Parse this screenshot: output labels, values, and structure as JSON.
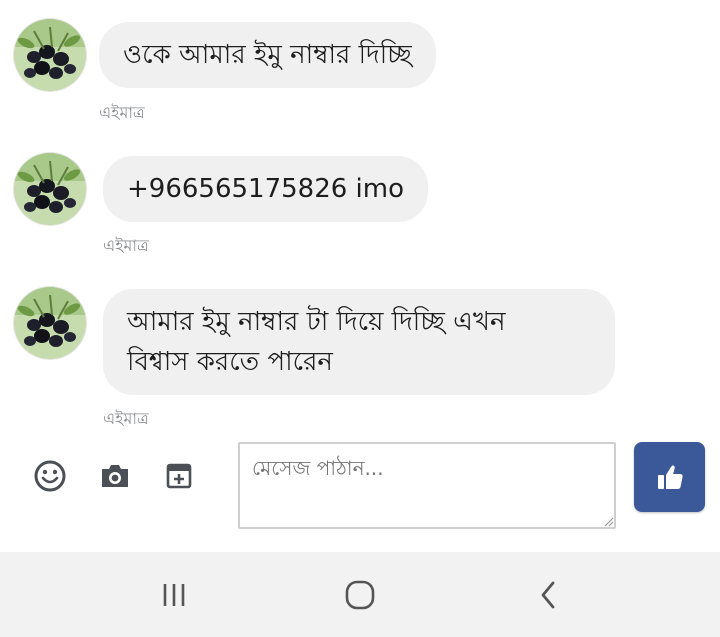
{
  "messages": [
    {
      "text": "ওকে আমার ইমু নাম্বার দিচ্ছি",
      "time": "এইমাত্র"
    },
    {
      "text": "+966565175826 imo",
      "time": "এইমাত্র"
    },
    {
      "text_line1": "আমার ইমু নাম্বার টা দিয়ে দিচ্ছি এখন",
      "text_line2": "বিশ্বাস করতে পারেন",
      "time": "এইমাত্র"
    }
  ],
  "composer": {
    "placeholder": "মেসেজ পাঠান...",
    "icons": [
      "emoji-icon",
      "camera-icon",
      "sticker-icon",
      "thumbs-up-icon"
    ],
    "like_color": "#3b5998"
  },
  "navbar": {
    "icons": [
      "recent-apps-icon",
      "home-icon",
      "back-icon"
    ]
  }
}
